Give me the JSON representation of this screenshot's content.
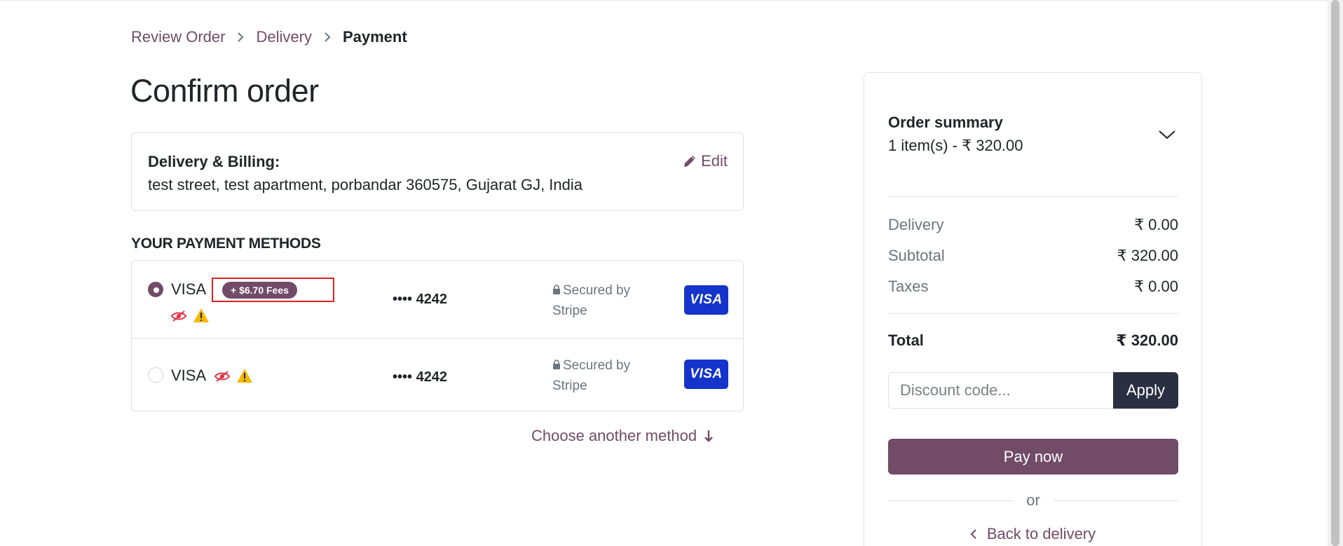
{
  "breadcrumb": {
    "items": [
      "Review Order",
      "Delivery",
      "Payment"
    ]
  },
  "page_title": "Confirm order",
  "delivery": {
    "title": "Delivery & Billing:",
    "address": "test street, test apartment, porbandar 360575, Gujarat GJ, India",
    "edit_label": "Edit"
  },
  "payment": {
    "heading": "YOUR PAYMENT METHODS",
    "methods": [
      {
        "name": "VISA",
        "fee": "+ $6.70 Fees",
        "last4": "•••• 4242",
        "secured": "Secured by Stripe",
        "logo": "VISA",
        "selected": true
      },
      {
        "name": "VISA",
        "last4": "•••• 4242",
        "secured": "Secured by Stripe",
        "logo": "VISA",
        "selected": false
      }
    ],
    "choose_another": "Choose another method"
  },
  "summary": {
    "title": "Order summary",
    "items_line": "1 item(s) -  ₹ 320.00",
    "rows": {
      "delivery": {
        "label": "Delivery",
        "value": "₹ 0.00"
      },
      "subtotal": {
        "label": "Subtotal",
        "value": "₹ 320.00"
      },
      "taxes": {
        "label": "Taxes",
        "value": "₹ 0.00"
      },
      "total": {
        "label": "Total",
        "value": "₹ 320.00"
      }
    },
    "discount_placeholder": "Discount code...",
    "apply_label": "Apply",
    "pay_label": "Pay now",
    "or_label": "or",
    "back_label": "Back to delivery"
  },
  "colors": {
    "accent": "#714b67",
    "dark_button": "#2a3042",
    "visa_blue": "#1434cb",
    "highlight_red": "#e02020",
    "warning": "#f5b800",
    "danger": "#dc3545"
  },
  "icons": [
    "chevron-right-icon",
    "pencil-icon",
    "eye-slash-icon",
    "warning-icon",
    "lock-icon",
    "arrow-down-icon",
    "chevron-down-icon",
    "chevron-left-icon"
  ]
}
